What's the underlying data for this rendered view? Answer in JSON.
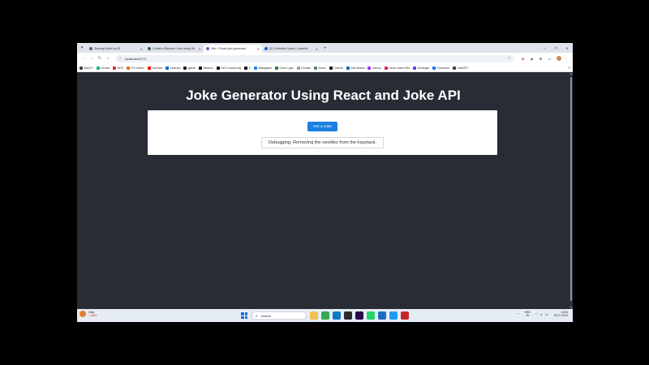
{
  "browser": {
    "tabs": [
      {
        "title": "Scoring Article by ID",
        "icon_color": "#5f6368",
        "active": false
      },
      {
        "title": "Create a Random Joke using Re",
        "icon_color": "#2f6b2f",
        "active": false
      },
      {
        "title": "Vite + React joke generator",
        "icon_color": "#7e57c2",
        "active": true
      },
      {
        "title": "(2) Surender Gupta | LinkedIn",
        "icon_color": "#0a66c2",
        "active": false
      }
    ],
    "new_tab": "+",
    "url": "localhost:5173",
    "bookmarks": [
      {
        "label": "BAUCY",
        "color": "#444444"
      },
      {
        "label": "Groww",
        "color": "#00b386"
      },
      {
        "label": "NDE",
        "color": "#d93025"
      },
      {
        "label": "IPU Watch",
        "color": "#e37400"
      },
      {
        "label": "YouTube",
        "color": "#ff0000"
      },
      {
        "label": "Linkedin",
        "color": "#0a66c2"
      },
      {
        "label": "github",
        "color": "#222222"
      },
      {
        "label": "Medium",
        "color": "#111111"
      },
      {
        "label": "DEV Community",
        "color": "#111111"
      },
      {
        "label": "X",
        "color": "#111111"
      },
      {
        "label": "Malayalam",
        "color": "#1e88e5"
      },
      {
        "label": "Dhan Login",
        "color": "#2e7d32"
      },
      {
        "label": "Domain",
        "color": "#9e9e9e"
      },
      {
        "label": "Ineins",
        "color": "#607d8b"
      },
      {
        "label": "CrazZie",
        "color": "#111111"
      },
      {
        "label": "Skill Nation",
        "color": "#1565c0"
      },
      {
        "label": "Udemy",
        "color": "#a435f0"
      },
      {
        "label": "Harsh sheet DSA",
        "color": "#d81b60"
      },
      {
        "label": "Hostinger",
        "color": "#673de6"
      },
      {
        "label": "Facebook",
        "color": "#1877f2"
      },
      {
        "label": "ChatGPT",
        "color": "#444444"
      }
    ],
    "bookmarks_more": "»"
  },
  "app": {
    "title": "Joke Generator Using React and Joke API",
    "button_label": "Get a Joke",
    "joke_text": "Debugging: Removing the needles from the haystack."
  },
  "taskbar": {
    "weather_title": "Gold",
    "weather_sub": "-1.80%",
    "search_placeholder": "Search",
    "apps": [
      {
        "name": "file-explorer",
        "color": "#f2c14e"
      },
      {
        "name": "chrome",
        "color": "#34a853"
      },
      {
        "name": "edge",
        "color": "#0c7ac5"
      },
      {
        "name": "terminal",
        "color": "#2b2b2b"
      },
      {
        "name": "premiere",
        "color": "#2a0a4a"
      },
      {
        "name": "whatsapp",
        "color": "#25d366"
      },
      {
        "name": "photos",
        "color": "#1b6ec2"
      },
      {
        "name": "vscode",
        "color": "#1f9cf0"
      },
      {
        "name": "recorder",
        "color": "#c62828"
      }
    ],
    "lang_top": "ENG",
    "lang_bottom": "IN",
    "time": "13:53",
    "date": "26-07-2023"
  }
}
